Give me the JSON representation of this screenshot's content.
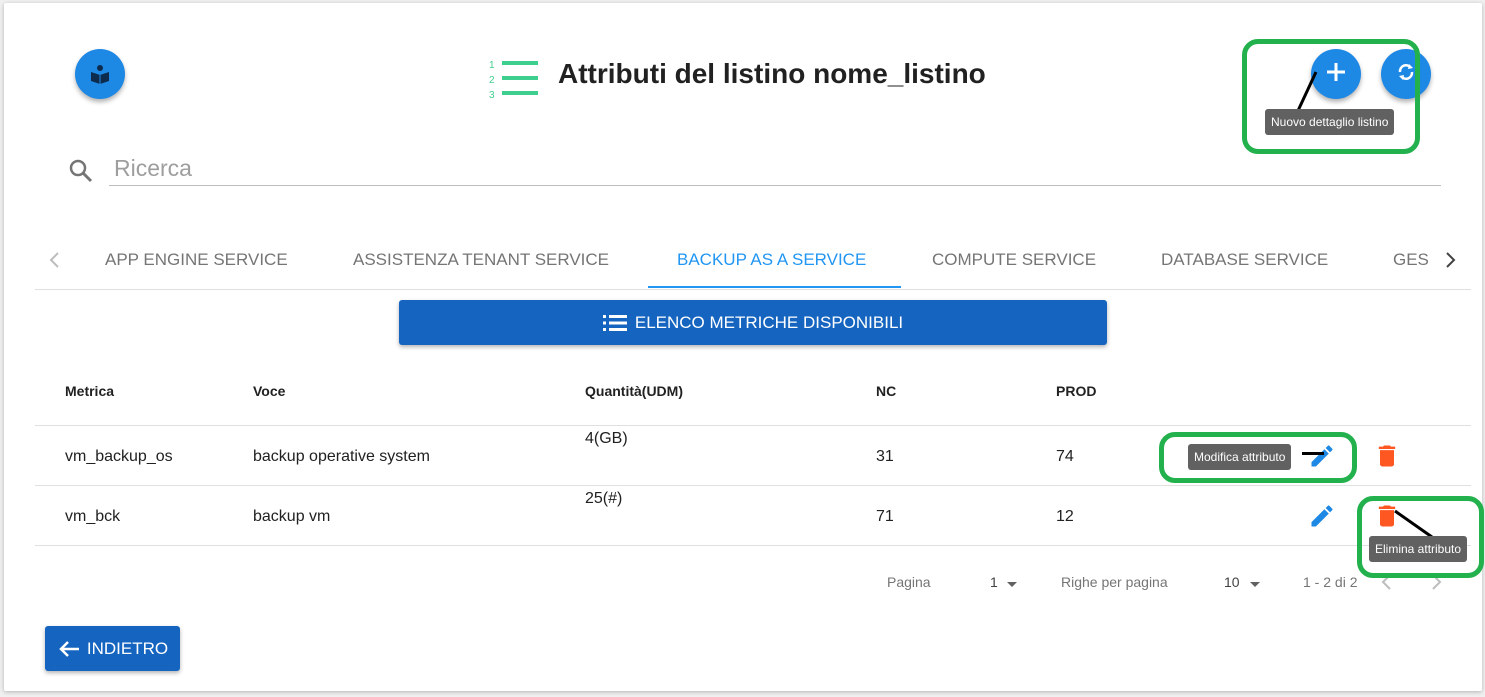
{
  "header": {
    "title": "Attributi del listino nome_listino",
    "logo_icon": "book-reader-icon",
    "list_icon": "numbered-list-icon",
    "add_icon": "plus-icon",
    "refresh_icon": "refresh-icon",
    "add_tooltip": "Nuovo dettaglio listino",
    "accent_color": "#1e88e5"
  },
  "search": {
    "placeholder": "Ricerca",
    "icon": "search-icon"
  },
  "tabs": {
    "items": [
      {
        "label": "APP ENGINE SERVICE"
      },
      {
        "label": "ASSISTENZA TENANT SERVICE"
      },
      {
        "label": "BACKUP AS A SERVICE",
        "active": true
      },
      {
        "label": "COMPUTE SERVICE"
      },
      {
        "label": "DATABASE SERVICE"
      },
      {
        "label": "GES"
      }
    ]
  },
  "metrics_button": {
    "label": "ELENCO METRICHE DISPONIBILI",
    "icon": "list-icon"
  },
  "table": {
    "headers": [
      "Metrica",
      "Voce",
      "Quantità(UDM)",
      "NC",
      "PROD"
    ],
    "rows": [
      {
        "metrica": "vm_backup_os",
        "voce": "backup operative system",
        "quantita": "4(GB)",
        "nc": "31",
        "prod": "74"
      },
      {
        "metrica": "vm_bck",
        "voce": "backup vm",
        "quantita": "25(#)",
        "nc": "71",
        "prod": "12"
      }
    ],
    "edit_tooltip": "Modifica attributo",
    "delete_tooltip": "Elimina attributo",
    "edit_color": "#1e88e5",
    "delete_color": "#ff5722"
  },
  "pagination": {
    "page_label": "Pagina",
    "page_value": "1",
    "rows_label": "Righe per pagina",
    "rows_value": "10",
    "range": "1 - 2 di 2"
  },
  "back_button": {
    "label": "INDIETRO",
    "icon": "arrow-left-icon"
  },
  "highlight_color": "#22b14c"
}
